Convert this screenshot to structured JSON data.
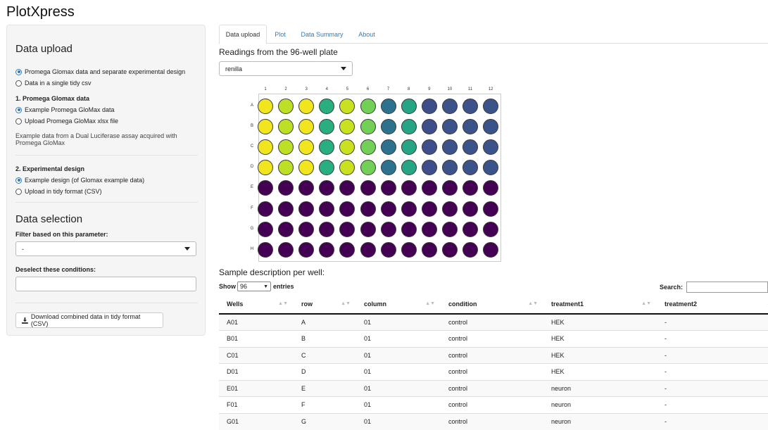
{
  "app": {
    "title": "PlotXpress"
  },
  "sidebar": {
    "upload_title": "Data upload",
    "source_options": [
      {
        "label": "Promega Glomax data and separate experimental design",
        "selected": true
      },
      {
        "label": "Data in a single tidy csv",
        "selected": false
      }
    ],
    "glomax": {
      "heading": "1. Promega Glomax data",
      "options": [
        {
          "label": "Example Promega GloMax data",
          "selected": true
        },
        {
          "label": "Upload Promega GloMax xlsx file",
          "selected": false
        }
      ],
      "help_line1": "Example data from a Dual Luciferase assay acquired with",
      "help_line2": "Promega GloMax"
    },
    "design": {
      "heading": "2. Experimental design",
      "options": [
        {
          "label": "Example design (of Glomax example data)",
          "selected": true
        },
        {
          "label": "Upload in tidy format (CSV)",
          "selected": false
        }
      ]
    },
    "selection_title": "Data selection",
    "filter_label": "Filter based on this parameter:",
    "filter_value": "-",
    "deselect_label": "Deselect these conditions:",
    "deselect_value": "",
    "download_label": "Download combined data in tidy format (CSV)"
  },
  "tabs": [
    {
      "label": "Data upload",
      "active": true
    },
    {
      "label": "Plot",
      "active": false
    },
    {
      "label": "Data Summary",
      "active": false
    },
    {
      "label": "About",
      "active": false
    }
  ],
  "plate": {
    "heading": "Readings from the 96-well plate",
    "reading_select": "renilla",
    "columns": [
      "1",
      "2",
      "3",
      "4",
      "5",
      "6",
      "7",
      "8",
      "9",
      "10",
      "11",
      "12"
    ],
    "rows": [
      "A",
      "B",
      "C",
      "D",
      "E",
      "F",
      "G",
      "H"
    ],
    "well_colors": {
      "row_A": [
        "#f1e51d",
        "#bddf26",
        "#f1e51d",
        "#29af7f",
        "#cae11f",
        "#73d056",
        "#2c728e",
        "#25a584",
        "#3d4e8a",
        "#3b528b",
        "#3b528b",
        "#3a538b"
      ],
      "row_B": [
        "#f1e51d",
        "#bddf26",
        "#f1e51d",
        "#29af7f",
        "#cae11f",
        "#73d056",
        "#2c728e",
        "#25a584",
        "#3d4e8a",
        "#3b528b",
        "#3b528b",
        "#3a538b"
      ],
      "row_C": [
        "#f1e51d",
        "#bddf26",
        "#f1e51d",
        "#29af7f",
        "#cae11f",
        "#73d056",
        "#2c728e",
        "#25a584",
        "#3d4e8a",
        "#3b528b",
        "#3b528b",
        "#3a538b"
      ],
      "row_D": [
        "#f1e51d",
        "#bddf26",
        "#f1e51d",
        "#29af7f",
        "#cae11f",
        "#73d056",
        "#2c728e",
        "#25a584",
        "#3d4e8a",
        "#3b528b",
        "#3b528b",
        "#3a538b"
      ],
      "low": "#440154"
    }
  },
  "sample_table": {
    "heading": "Sample description per well:",
    "show_label": "Show",
    "entries_value": "96",
    "entries_label": "entries",
    "search_label": "Search:",
    "search_value": "",
    "columns": [
      "Wells",
      "row",
      "column",
      "condition",
      "treatment1",
      "treatment2"
    ],
    "rows": [
      [
        "A01",
        "A",
        "01",
        "control",
        "HEK",
        "-"
      ],
      [
        "B01",
        "B",
        "01",
        "control",
        "HEK",
        "-"
      ],
      [
        "C01",
        "C",
        "01",
        "control",
        "HEK",
        "-"
      ],
      [
        "D01",
        "D",
        "01",
        "control",
        "HEK",
        "-"
      ],
      [
        "E01",
        "E",
        "01",
        "control",
        "neuron",
        "-"
      ],
      [
        "F01",
        "F",
        "01",
        "control",
        "neuron",
        "-"
      ],
      [
        "G01",
        "G",
        "01",
        "control",
        "neuron",
        "-"
      ]
    ]
  }
}
